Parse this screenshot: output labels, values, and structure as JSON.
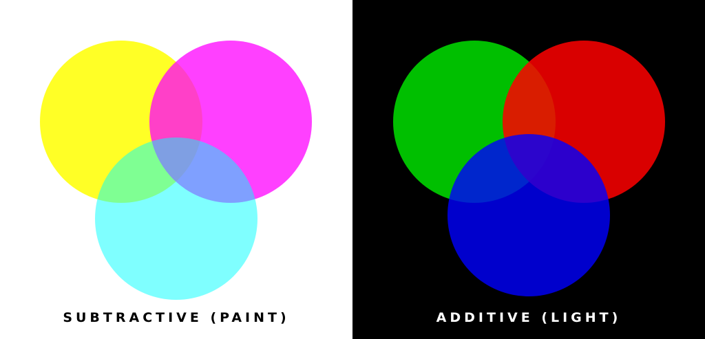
{
  "subtractive": {
    "caption": "SUBTRACTIVE (PAINT)",
    "circles": [
      {
        "name": "yellow-circle",
        "color": "#ffff00"
      },
      {
        "name": "magenta-circle",
        "color": "#ff00ff"
      },
      {
        "name": "cyan-circle",
        "color": "#00ffff"
      }
    ],
    "background": "#ffffff"
  },
  "additive": {
    "caption": "ADDITIVE (LIGHT)",
    "circles": [
      {
        "name": "green-circle",
        "color": "#00ff00"
      },
      {
        "name": "red-circle",
        "color": "#ff0000"
      },
      {
        "name": "blue-circle",
        "color": "#0000ff"
      }
    ],
    "background": "#000000"
  }
}
